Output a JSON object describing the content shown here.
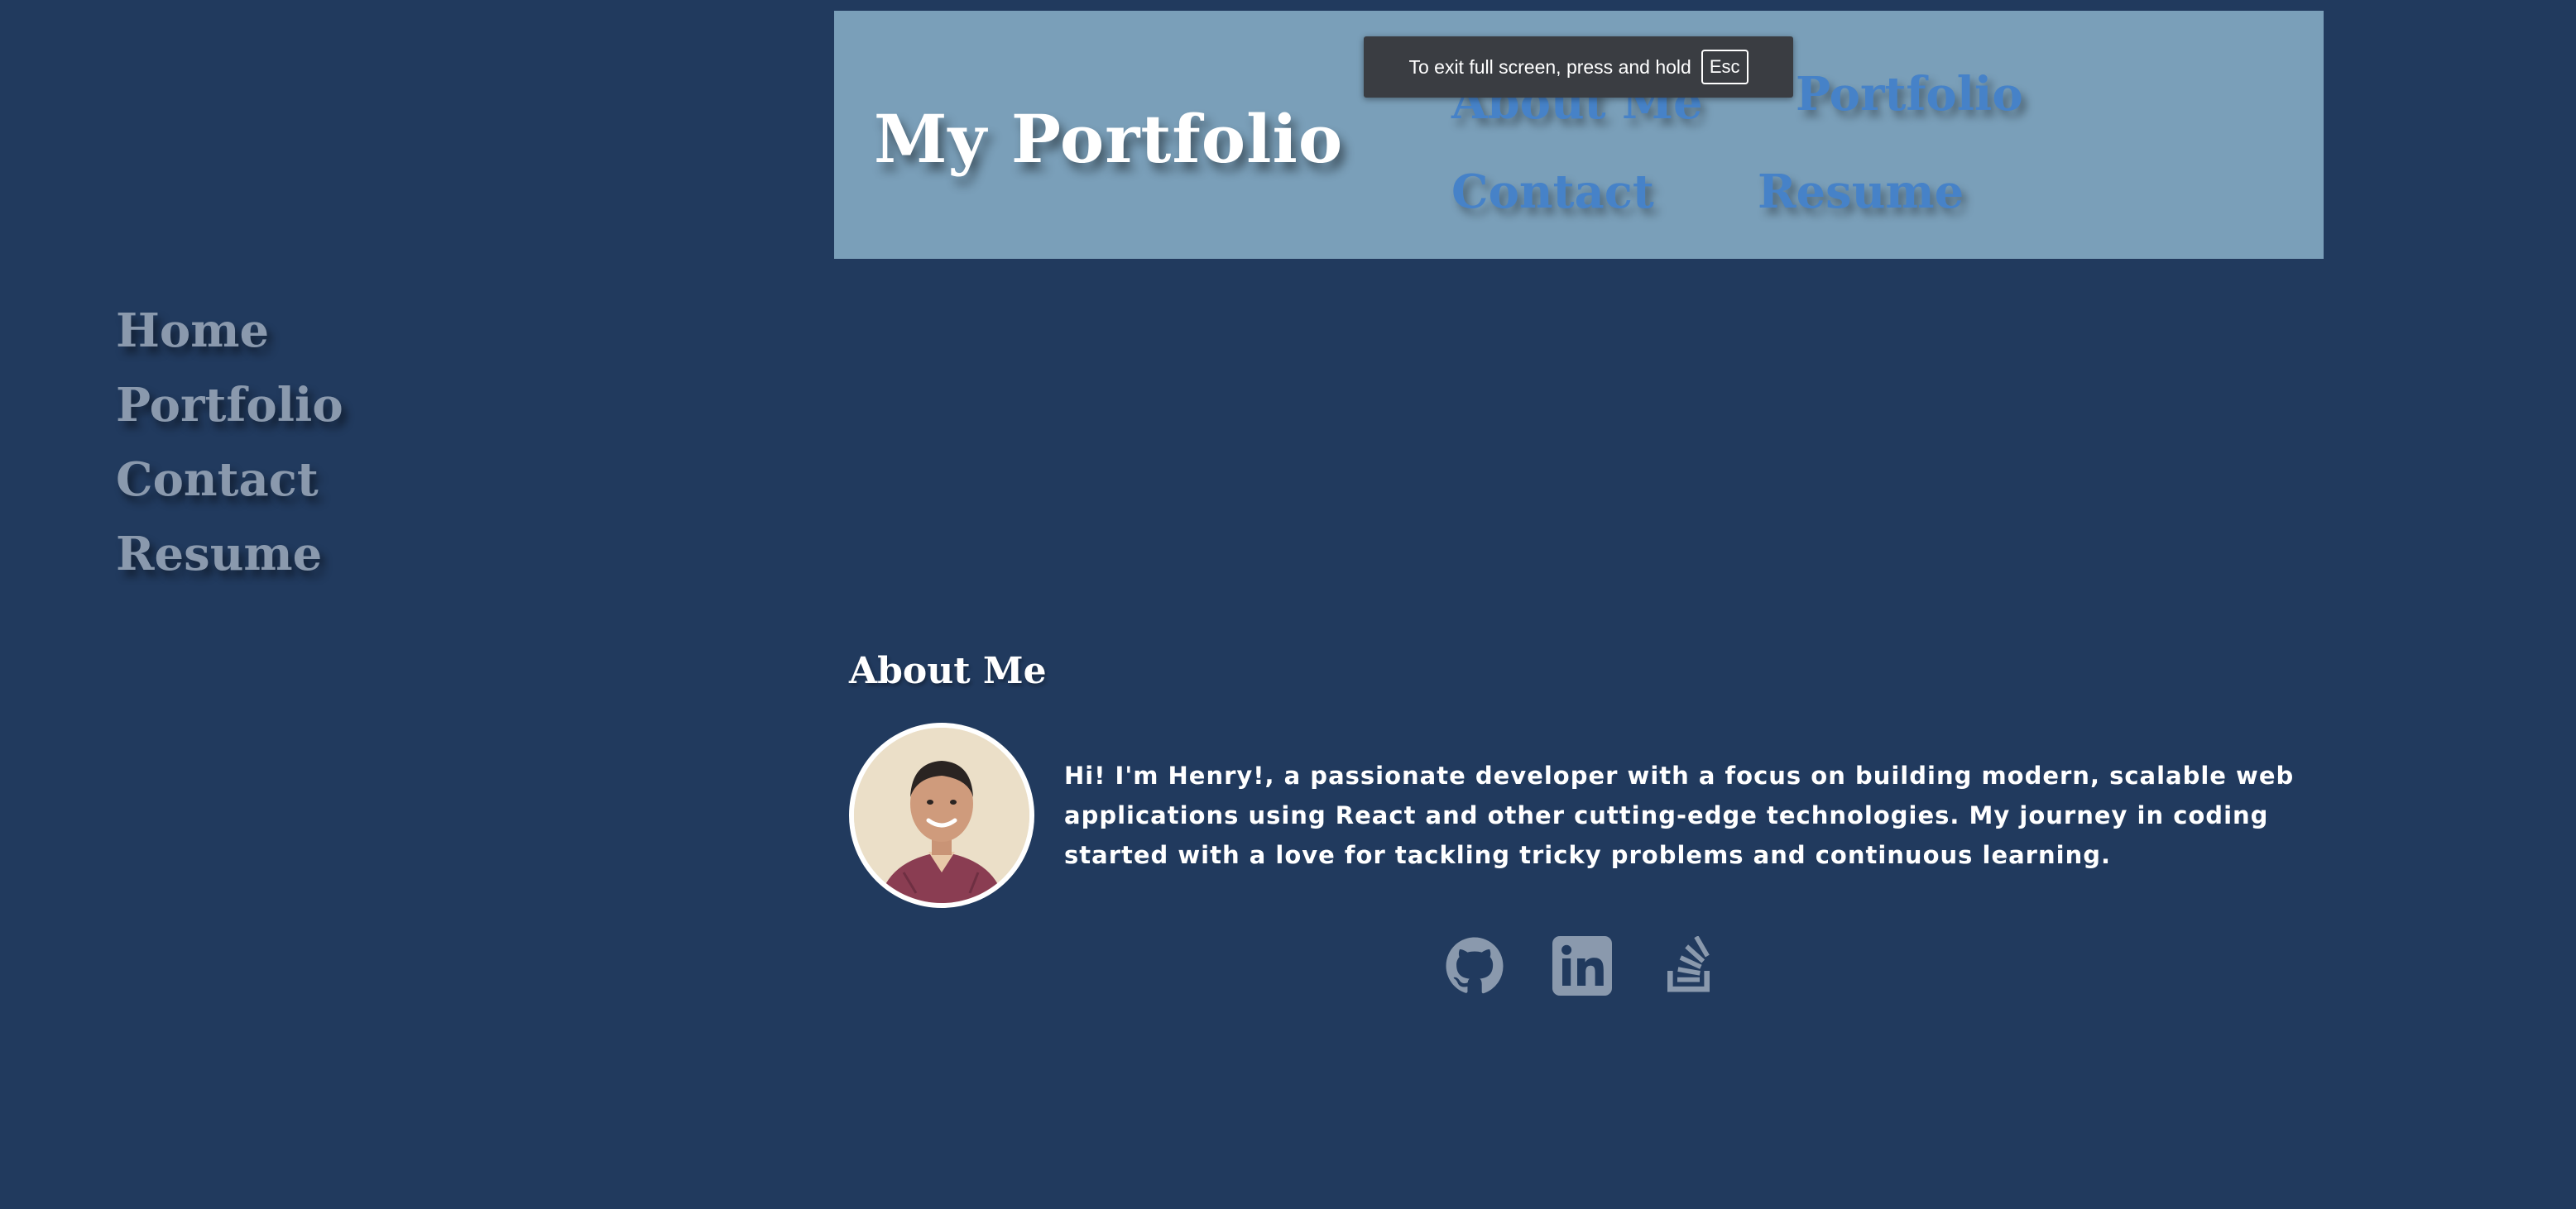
{
  "header": {
    "brand": "My Portfolio",
    "nav": {
      "about": "About Me",
      "portfolio": "Portfolio",
      "contact": "Contact",
      "resume": "Resume"
    }
  },
  "fullscreen_toast": {
    "message": "To exit full screen, press and hold",
    "key": "Esc"
  },
  "side_nav": {
    "items": [
      "Home",
      "Portfolio",
      "Contact",
      "Resume"
    ]
  },
  "about": {
    "title": "About Me",
    "bio": "Hi! I'm Henry!, a passionate developer with a focus on building modern, scalable web applications using React and other cutting-edge technologies. My journey in coding started with a love for tackling tricky problems and continuous learning."
  },
  "social": {
    "icons": [
      "github-icon",
      "linkedin-icon",
      "stackoverflow-icon"
    ]
  },
  "colors": {
    "background": "#213a5e",
    "header_bg": "#7a9fb9",
    "top_nav_link": "#4682c8",
    "side_nav_link": "#8a99ad",
    "social_icon": "#8a99ad"
  }
}
